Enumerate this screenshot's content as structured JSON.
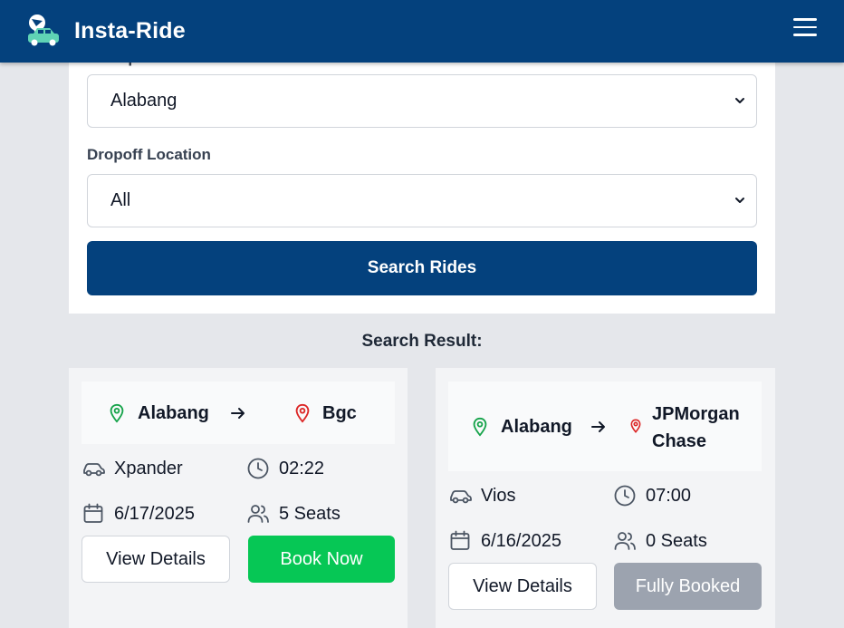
{
  "app": {
    "name": "Insta-Ride",
    "logo_icon": "car-pin-logo-icon",
    "menu_icon": "hamburger-menu-icon"
  },
  "colors": {
    "primary": "#04417d",
    "success": "#06c755",
    "disabled": "#9ca3af",
    "pickup_pin": "#16a34a",
    "dropoff_pin": "#dc2626"
  },
  "search": {
    "pickup_label_partial": "Pickup Location",
    "pickup_value": "Alabang",
    "dropoff_label": "Dropoff Location",
    "dropoff_value": "All",
    "search_button": "Search Rides"
  },
  "results": {
    "title": "Search Result:",
    "rides": [
      {
        "from": "Alabang",
        "to": "Bgc",
        "vehicle": "Xpander",
        "time": "02:22",
        "date": "6/17/2025",
        "seats": "5 Seats",
        "details_button": "View Details",
        "action_button": "Book Now",
        "action_state": "available"
      },
      {
        "from": "Alabang",
        "to_line1": "JPMorgan",
        "to_line2": "Chase",
        "vehicle": "Vios",
        "time": "07:00",
        "date": "6/16/2025",
        "seats": "0 Seats",
        "details_button": "View Details",
        "action_button": "Fully Booked",
        "action_state": "full"
      }
    ]
  }
}
